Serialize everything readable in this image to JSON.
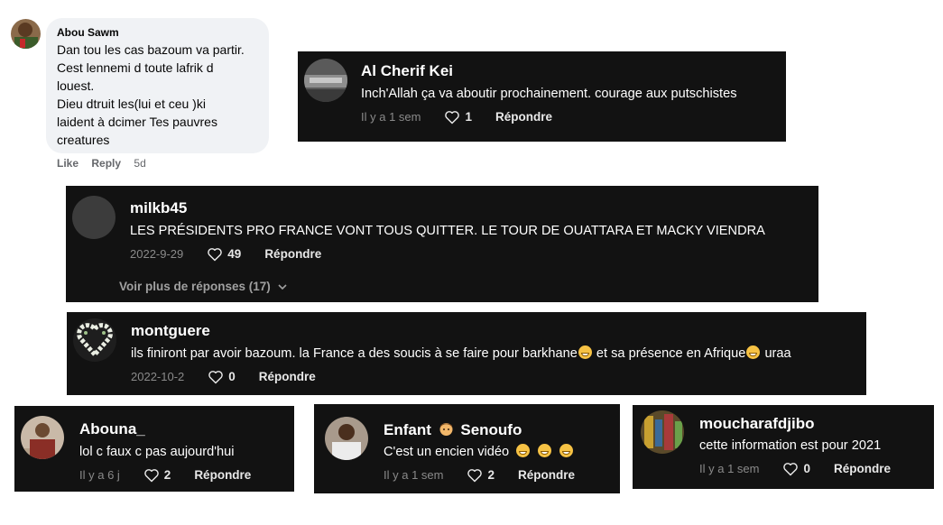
{
  "facebook_comment": {
    "author": "Abou Sawm",
    "text": "Dan tou les cas bazoum va partir.\nCest lennemi d toute lafrik d\nlouest.\nDieu dtruit les(lui et ceu )ki\nlaident à dcimer Tes pauvres\ncreatures",
    "like_label": "Like",
    "reply_label": "Reply",
    "time": "5d"
  },
  "comments": [
    {
      "author": "Al Cherif Kei",
      "text": "Inch'Allah ça va aboutir prochainement. courage aux putschistes",
      "date": "Il y a 1 sem",
      "likes": "1",
      "reply_label": "Répondre"
    },
    {
      "author": "milkb45",
      "text": "LES PRÉSIDENTS PRO FRANCE VONT TOUS QUITTER. LE TOUR DE OUATTARA ET MACKY VIENDRA",
      "date": "2022-9-29",
      "likes": "49",
      "reply_label": "Répondre",
      "more_replies": "Voir plus de réponses (17)"
    },
    {
      "author": "montguere",
      "text_parts": [
        "ils finiront par avoir bazoum. la France a des soucis à se faire pour barkhane",
        " et sa présence en Afrique",
        " uraa"
      ],
      "date": "2022-10-2",
      "likes": "0",
      "reply_label": "Répondre"
    },
    {
      "author": "Abouna_",
      "text": "lol c faux c pas aujourd'hui",
      "date": "Il y a 6 j",
      "likes": "2",
      "reply_label": "Répondre"
    },
    {
      "author_parts": [
        "Enfant",
        "Senoufo"
      ],
      "text": "C'est un encien vidéo",
      "date": "Il y a 1 sem",
      "likes": "2",
      "reply_label": "Répondre"
    },
    {
      "author": "moucharafdjibo",
      "text": "cette information est pour 2021",
      "date": "Il y a 1 sem",
      "likes": "0",
      "reply_label": "Répondre"
    }
  ],
  "icons": {
    "like": "heart-outline-icon",
    "expand": "chevron-down-icon",
    "laugh_emoji": "grinning-face-emoji",
    "person_emoji": "man-face-emoji"
  },
  "colors": {
    "card_bg": "#121212",
    "fb_bubble": "#f0f2f5",
    "meta_gray": "#8a8a8a"
  }
}
